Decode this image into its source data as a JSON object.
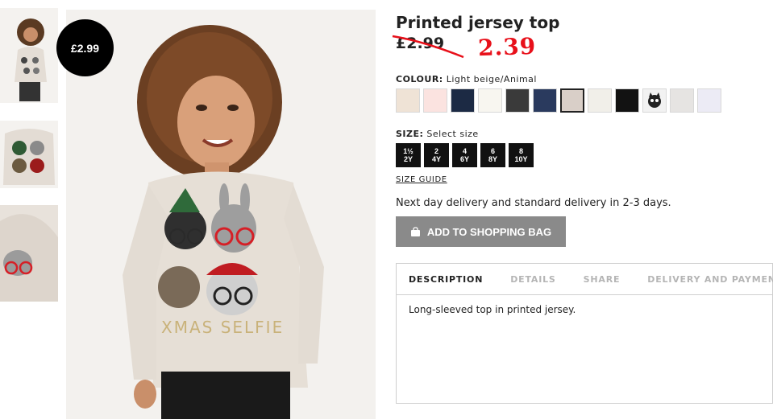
{
  "product": {
    "title": "Printed jersey top",
    "old_price": "£2.99",
    "new_price": "2.39",
    "badge_price": "£2.99"
  },
  "colour": {
    "label": "COLOUR:",
    "value": "Light beige/Animal",
    "swatches": [
      {
        "name": "beige",
        "color": "#efe3d6"
      },
      {
        "name": "light-pink",
        "color": "#fbe3e0"
      },
      {
        "name": "dark-navy",
        "color": "#1c2a44"
      },
      {
        "name": "white",
        "color": "#f8f6f0"
      },
      {
        "name": "dark-grey",
        "color": "#3a3a3a"
      },
      {
        "name": "navy",
        "color": "#2a3a5e"
      },
      {
        "name": "light-beige-animal",
        "color": "#d9cfc8"
      },
      {
        "name": "off-white",
        "color": "#f1efe9"
      },
      {
        "name": "black",
        "color": "#121212"
      },
      {
        "name": "animal-print",
        "color": "#f2f2f2"
      },
      {
        "name": "light-grey",
        "color": "#e6e4e2"
      },
      {
        "name": "lavender-white",
        "color": "#ecebf5"
      }
    ]
  },
  "size": {
    "label": "SIZE:",
    "placeholder": "Select size",
    "options": [
      {
        "top": "1½",
        "bottom": "2Y"
      },
      {
        "top": "2",
        "bottom": "4Y"
      },
      {
        "top": "4",
        "bottom": "6Y"
      },
      {
        "top": "6",
        "bottom": "8Y"
      },
      {
        "top": "8",
        "bottom": "10Y"
      }
    ],
    "guide": "SIZE GUIDE"
  },
  "delivery_text": "Next day delivery and standard delivery in 2-3 days.",
  "add_to_bag": "ADD TO SHOPPING BAG",
  "tabs": [
    "DESCRIPTION",
    "DETAILS",
    "SHARE",
    "DELIVERY AND PAYMENT"
  ],
  "description": "Long-sleeved top in printed jersey.",
  "main_image_text": "XMAS SELFIE"
}
